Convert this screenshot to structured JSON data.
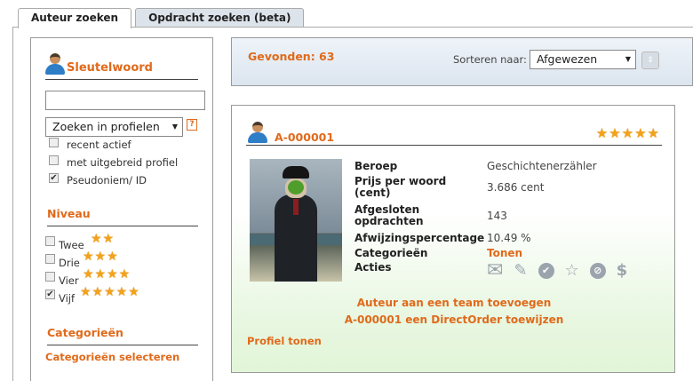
{
  "tabs": [
    {
      "label": "Auteur zoeken",
      "active": true
    },
    {
      "label": "Opdracht zoeken (beta)",
      "active": false
    }
  ],
  "sidebar": {
    "keyword_title": "Sleutelwoord",
    "search_value": "",
    "search_scope": "Zoeken in profielen",
    "help_label": "?",
    "filters": [
      {
        "label": "recent actief",
        "checked": false
      },
      {
        "label": "met uitgebreid profiel",
        "checked": false
      },
      {
        "label": "Pseudoniem/ ID",
        "checked": true
      }
    ],
    "level_title": "Niveau",
    "levels": [
      {
        "label": "Twee",
        "stars": 2,
        "checked": false
      },
      {
        "label": "Drie",
        "stars": 3,
        "checked": false
      },
      {
        "label": "Vier",
        "stars": 4,
        "checked": false
      },
      {
        "label": "Vijf",
        "stars": 5,
        "checked": true
      }
    ],
    "categories_title": "Categorieën",
    "categories_link": "Categorieën selecteren"
  },
  "results": {
    "found": "Gevonden: 63",
    "sort_label": "Sorteren naar:",
    "sort_value": "Afgewezen"
  },
  "card": {
    "id": "A-000001",
    "rating": 5,
    "fields": [
      {
        "label": "Beroep",
        "value": "Geschichtenerzähler"
      },
      {
        "label": "Prijs per woord (cent)",
        "value": "3.686 cent"
      },
      {
        "label": "Afgesloten opdrachten",
        "value": "143"
      },
      {
        "label": "Afwijzingspercentage",
        "value": "10.49 %"
      },
      {
        "label": "Categorieën",
        "value": "Tonen"
      },
      {
        "label": "Acties",
        "value": ""
      }
    ],
    "actions": [
      "mail-icon",
      "feather-icon",
      "check-circle-icon",
      "star-outline-icon",
      "block-icon",
      "dollar-icon"
    ],
    "add_team_link": "Auteur aan een team toevoegen",
    "direct_order_link": "A-000001 een DirectOrder toewijzen",
    "profile_link": "Profiel tonen"
  },
  "colors": {
    "accent": "#e06a1b",
    "star": "#f3a21b",
    "icon_gray": "#9ba4ad"
  }
}
